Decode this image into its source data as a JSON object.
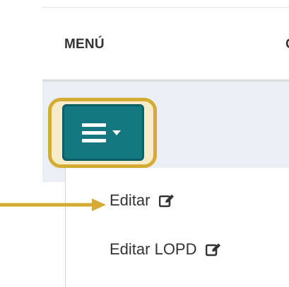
{
  "table": {
    "header_menu": "MENÚ",
    "header_next": "C"
  },
  "menu_button": {
    "icon": "bars-icon",
    "caret_icon": "caret-down-icon"
  },
  "dropdown": {
    "items": [
      {
        "label": "Editar",
        "icon": "edit-icon"
      },
      {
        "label": "Editar LOPD",
        "icon": "edit-icon"
      }
    ]
  },
  "colors": {
    "button": "#157780",
    "highlight": "#d4ab33",
    "row": "#eceef6",
    "text": "#333333"
  }
}
